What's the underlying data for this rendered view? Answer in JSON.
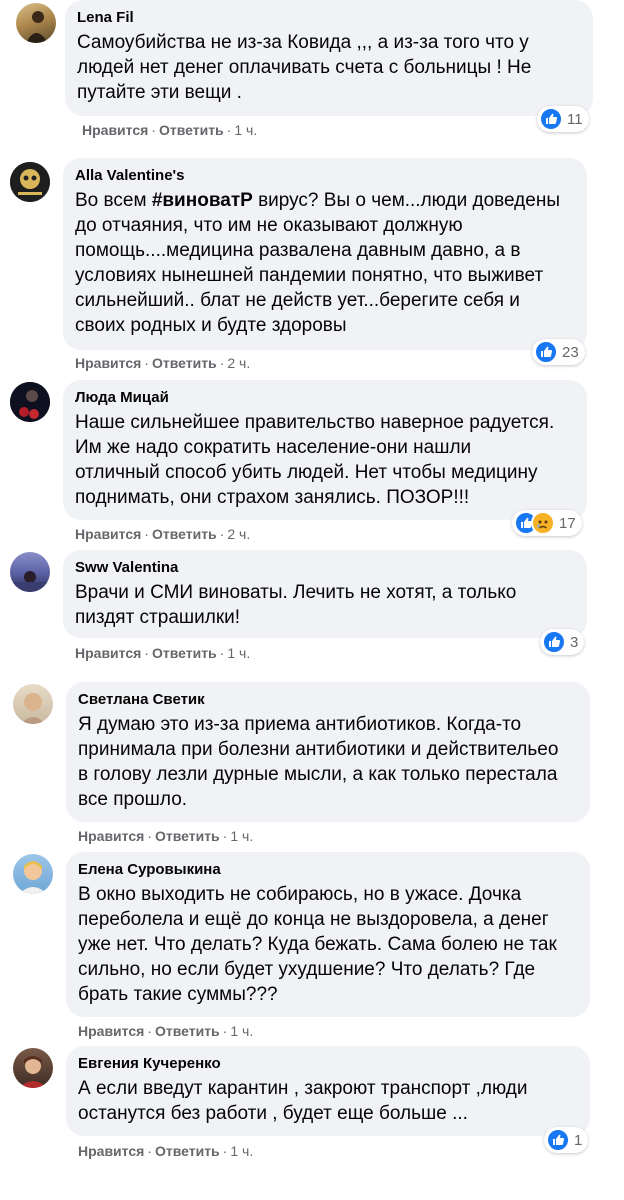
{
  "ui": {
    "like_label": "Нравится",
    "reply_label": "Ответить",
    "separator": "·"
  },
  "comments": [
    {
      "author": "Lena Fil",
      "lines": [
        "Самоубийства не из-за Ковида ,,, а из-за того что у",
        "людей нет денег оплачивать счета с больницы ! Не",
        "путайте эти вещи ."
      ],
      "time": "1 ч.",
      "reactions": "11"
    },
    {
      "author": "Alla Valentine's",
      "hashtag": "#виноватР",
      "line1_prefix": "Во всем ",
      "line1_suffix": " вирус? Вы о чем...люди доведены",
      "lines": [
        "до отчаяния, что им не оказывают должную",
        "помощь....медицина развалена давным давно, а в",
        "условиях нынешней пандемии понятно, что выживет",
        "сильнейший.. блат не действ ует...берегите себя и",
        "своих родных и будте здоровы"
      ],
      "time": "2 ч.",
      "reactions": "23"
    },
    {
      "author": "Люда Мицай",
      "lines": [
        "Наше сильнейшее правительство наверное радуется.",
        "Им же надо сократить население-они нашли",
        "отличный способ убить людей. Нет чтобы медицину",
        "поднимать, они страхом занялись. ПОЗОР!!!"
      ],
      "time": "2 ч.",
      "reactions": "17"
    },
    {
      "author": "Sww Valentina",
      "lines": [
        "Врачи и СМИ виноваты. Лечить не хотят, а только",
        "пиздят страшилки!"
      ],
      "time": "1 ч.",
      "reactions": "3"
    },
    {
      "author": "Светлана Светик",
      "lines": [
        "Я думаю это из-за приема антибиотиков. Когда-то",
        "принимала при болезни антибиотики и действительео",
        "в голову лезли дурные мысли, а как только перестала",
        "все прошло."
      ],
      "time": "1 ч."
    },
    {
      "author": "Елена Суровыкина",
      "lines": [
        "В окно выходить не собираюсь, но в ужасе. Дочка",
        "переболела и ещё до конца не выздоровела, а денег",
        "уже нет. Что делать? Куда бежать. Сама болею не так",
        "сильно, но если будет ухудшение? Что делать? Где",
        "брать такие суммы???"
      ],
      "time": "1 ч."
    },
    {
      "author": "Евгения Кучеренко",
      "lines": [
        "А если введут карантин , закроют транспорт ,люди",
        "останутся без работи , будет еще больше ..."
      ],
      "time": "1 ч.",
      "reactions": "1"
    }
  ]
}
